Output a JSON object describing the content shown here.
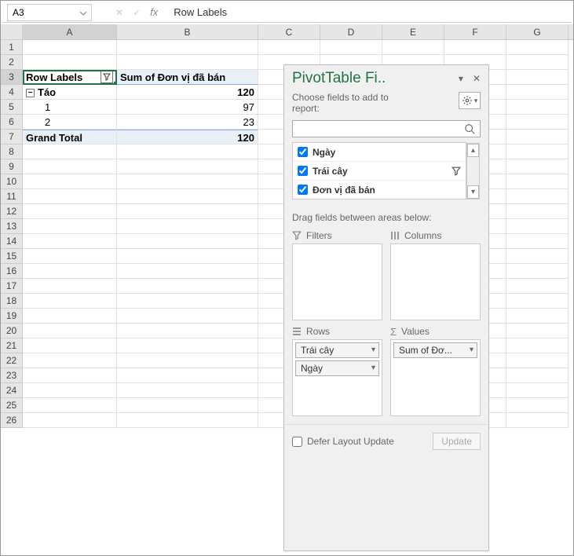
{
  "formula_bar": {
    "name_box": "A3",
    "fx_label": "fx",
    "content": "Row Labels"
  },
  "columns": [
    "A",
    "B",
    "C",
    "D",
    "E",
    "F",
    "G"
  ],
  "row_headers": [
    1,
    2,
    3,
    4,
    5,
    6,
    7,
    8,
    9,
    10,
    11,
    12,
    13,
    14,
    15,
    16,
    17,
    18,
    19,
    20,
    21,
    22,
    23,
    24,
    25,
    26
  ],
  "pivot": {
    "row3": {
      "a": "Row Labels",
      "b": "Sum of Đơn vị đã bán"
    },
    "row4": {
      "a": "Táo",
      "b": "120"
    },
    "row5": {
      "a": "1",
      "b": "97"
    },
    "row6": {
      "a": "2",
      "b": "23"
    },
    "row7": {
      "a": "Grand Total",
      "b": "120"
    }
  },
  "pane": {
    "title": "PivotTable Fi..",
    "choose_label": "Choose fields to add to report:",
    "search_placeholder": "",
    "fields": [
      {
        "name": "Ngày",
        "checked": true,
        "filter_icon": false
      },
      {
        "name": "Trái cây",
        "checked": true,
        "filter_icon": true
      },
      {
        "name": "Đơn vị đã bán",
        "checked": true,
        "filter_icon": false
      }
    ],
    "drag_hint": "Drag fields between areas below:",
    "areas": {
      "filters": {
        "title": "Filters",
        "items": []
      },
      "columns": {
        "title": "Columns",
        "items": []
      },
      "rows": {
        "title": "Rows",
        "items": [
          "Trái cây",
          "Ngày"
        ]
      },
      "values": {
        "title": "Values",
        "items": [
          "Sum of Đơ..."
        ]
      }
    },
    "defer_label": "Defer Layout Update",
    "update_label": "Update"
  }
}
